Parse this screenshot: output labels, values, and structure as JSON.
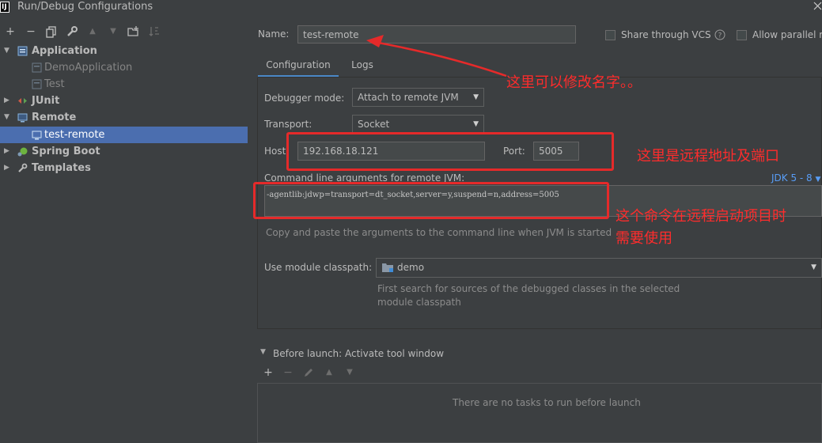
{
  "window": {
    "title": "Run/Debug Configurations",
    "logo": "IJ"
  },
  "tree": {
    "items": [
      {
        "label": "Application",
        "bold": true,
        "expanded": true
      },
      {
        "label": "DemoApplication",
        "dim": true
      },
      {
        "label": "Test",
        "dim": true
      },
      {
        "label": "JUnit",
        "bold": true,
        "expanded": false
      },
      {
        "label": "Remote",
        "bold": true,
        "expanded": true
      },
      {
        "label": "test-remote",
        "selected": true
      },
      {
        "label": "Spring Boot",
        "bold": true,
        "expanded": false
      },
      {
        "label": "Templates",
        "bold": true,
        "expanded": false
      }
    ]
  },
  "header": {
    "name_label": "Name:",
    "name_value": "test-remote",
    "share_label": "Share through VCS",
    "allow_parallel_label": "Allow parallel r"
  },
  "tabs": [
    {
      "label": "Configuration",
      "active": true
    },
    {
      "label": "Logs",
      "active": false
    }
  ],
  "config": {
    "debugger_mode_label": "Debugger mode:",
    "debugger_mode_value": "Attach to remote JVM",
    "transport_label": "Transport:",
    "transport_value": "Socket",
    "host_label": "Host:",
    "host_value": "192.168.18.121",
    "port_label": "Port:",
    "port_value": "5005",
    "cmd_label": "Command line arguments for remote JVM:",
    "jdk_label": "JDK 5 - 8",
    "cmd_value": "-agentlib:jdwp=transport=dt_socket,server=y,suspend=n,address=5005",
    "cmd_hint": "Copy and paste the arguments to the command line when JVM is started",
    "module_label": "Use module classpath:",
    "module_value": "demo",
    "module_hint_1": "First search for sources of the debugged classes in the selected",
    "module_hint_2": "module classpath"
  },
  "before_launch": {
    "title": "Before launch: Activate tool window",
    "empty_text": "There are no tasks to run before launch"
  },
  "annotations": {
    "note_name": "这里可以修改名字。。",
    "note_host": "这里是远程地址及端口",
    "note_cmd_1": "这个命令在远程启动项目时",
    "note_cmd_2": "需要使用",
    "color": "#e52a2a"
  },
  "colors": {
    "background": "#3c3f41",
    "selection": "#4b6eaf",
    "accent": "#4a88c7"
  }
}
